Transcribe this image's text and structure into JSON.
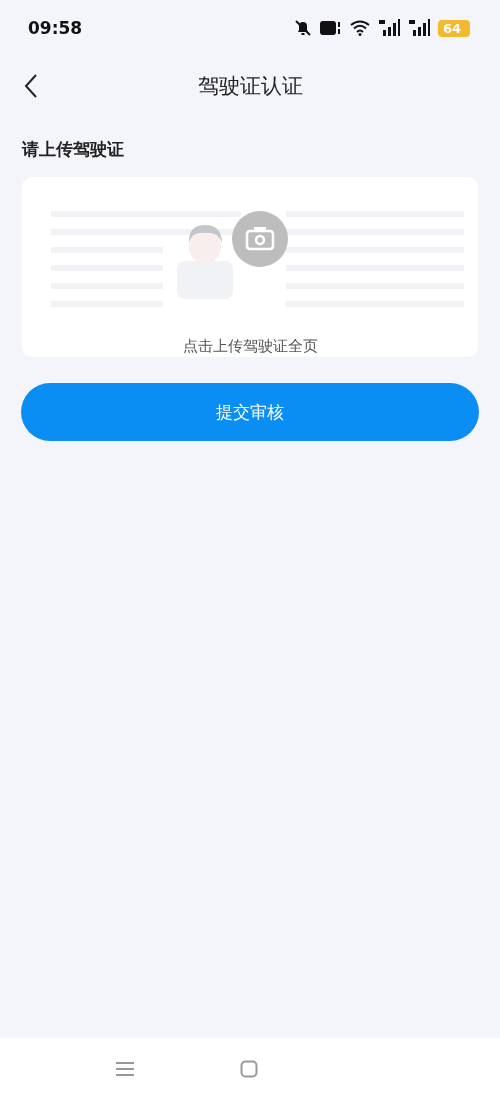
{
  "status_bar": {
    "time": "09:58",
    "battery": "64"
  },
  "header": {
    "title": "驾驶证认证"
  },
  "section": {
    "label": "请上传驾驶证"
  },
  "upload": {
    "caption": "点击上传驾驶证全页"
  },
  "submit": {
    "label": "提交审核"
  }
}
